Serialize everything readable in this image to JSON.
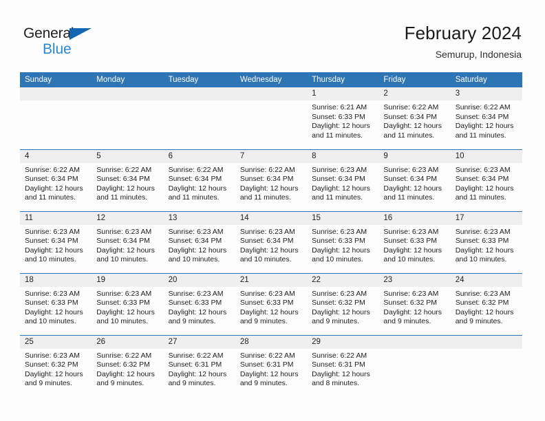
{
  "brand": {
    "name_top": "General",
    "name_bottom": "Blue",
    "triangle_icon": "triangle-icon",
    "accent_blue": "#2787d6",
    "logo_dark": "#231f20"
  },
  "header": {
    "title": "February 2024",
    "subtitle": "Semurup, Indonesia"
  },
  "theme": {
    "header_blue": "#2e75b6",
    "daynum_band": "#efefef",
    "page_bg": "#fdfdfd"
  },
  "calendar": {
    "weekday_headers": [
      "Sunday",
      "Monday",
      "Tuesday",
      "Wednesday",
      "Thursday",
      "Friday",
      "Saturday"
    ],
    "weeks": [
      [
        {
          "day": "",
          "sunrise": "",
          "sunset": "",
          "daylight1": "",
          "daylight2": ""
        },
        {
          "day": "",
          "sunrise": "",
          "sunset": "",
          "daylight1": "",
          "daylight2": ""
        },
        {
          "day": "",
          "sunrise": "",
          "sunset": "",
          "daylight1": "",
          "daylight2": ""
        },
        {
          "day": "",
          "sunrise": "",
          "sunset": "",
          "daylight1": "",
          "daylight2": ""
        },
        {
          "day": "1",
          "sunrise": "Sunrise: 6:21 AM",
          "sunset": "Sunset: 6:33 PM",
          "daylight1": "Daylight: 12 hours",
          "daylight2": "and 11 minutes."
        },
        {
          "day": "2",
          "sunrise": "Sunrise: 6:22 AM",
          "sunset": "Sunset: 6:34 PM",
          "daylight1": "Daylight: 12 hours",
          "daylight2": "and 11 minutes."
        },
        {
          "day": "3",
          "sunrise": "Sunrise: 6:22 AM",
          "sunset": "Sunset: 6:34 PM",
          "daylight1": "Daylight: 12 hours",
          "daylight2": "and 11 minutes."
        }
      ],
      [
        {
          "day": "4",
          "sunrise": "Sunrise: 6:22 AM",
          "sunset": "Sunset: 6:34 PM",
          "daylight1": "Daylight: 12 hours",
          "daylight2": "and 11 minutes."
        },
        {
          "day": "5",
          "sunrise": "Sunrise: 6:22 AM",
          "sunset": "Sunset: 6:34 PM",
          "daylight1": "Daylight: 12 hours",
          "daylight2": "and 11 minutes."
        },
        {
          "day": "6",
          "sunrise": "Sunrise: 6:22 AM",
          "sunset": "Sunset: 6:34 PM",
          "daylight1": "Daylight: 12 hours",
          "daylight2": "and 11 minutes."
        },
        {
          "day": "7",
          "sunrise": "Sunrise: 6:22 AM",
          "sunset": "Sunset: 6:34 PM",
          "daylight1": "Daylight: 12 hours",
          "daylight2": "and 11 minutes."
        },
        {
          "day": "8",
          "sunrise": "Sunrise: 6:23 AM",
          "sunset": "Sunset: 6:34 PM",
          "daylight1": "Daylight: 12 hours",
          "daylight2": "and 11 minutes."
        },
        {
          "day": "9",
          "sunrise": "Sunrise: 6:23 AM",
          "sunset": "Sunset: 6:34 PM",
          "daylight1": "Daylight: 12 hours",
          "daylight2": "and 11 minutes."
        },
        {
          "day": "10",
          "sunrise": "Sunrise: 6:23 AM",
          "sunset": "Sunset: 6:34 PM",
          "daylight1": "Daylight: 12 hours",
          "daylight2": "and 11 minutes."
        }
      ],
      [
        {
          "day": "11",
          "sunrise": "Sunrise: 6:23 AM",
          "sunset": "Sunset: 6:34 PM",
          "daylight1": "Daylight: 12 hours",
          "daylight2": "and 10 minutes."
        },
        {
          "day": "12",
          "sunrise": "Sunrise: 6:23 AM",
          "sunset": "Sunset: 6:34 PM",
          "daylight1": "Daylight: 12 hours",
          "daylight2": "and 10 minutes."
        },
        {
          "day": "13",
          "sunrise": "Sunrise: 6:23 AM",
          "sunset": "Sunset: 6:34 PM",
          "daylight1": "Daylight: 12 hours",
          "daylight2": "and 10 minutes."
        },
        {
          "day": "14",
          "sunrise": "Sunrise: 6:23 AM",
          "sunset": "Sunset: 6:34 PM",
          "daylight1": "Daylight: 12 hours",
          "daylight2": "and 10 minutes."
        },
        {
          "day": "15",
          "sunrise": "Sunrise: 6:23 AM",
          "sunset": "Sunset: 6:33 PM",
          "daylight1": "Daylight: 12 hours",
          "daylight2": "and 10 minutes."
        },
        {
          "day": "16",
          "sunrise": "Sunrise: 6:23 AM",
          "sunset": "Sunset: 6:33 PM",
          "daylight1": "Daylight: 12 hours",
          "daylight2": "and 10 minutes."
        },
        {
          "day": "17",
          "sunrise": "Sunrise: 6:23 AM",
          "sunset": "Sunset: 6:33 PM",
          "daylight1": "Daylight: 12 hours",
          "daylight2": "and 10 minutes."
        }
      ],
      [
        {
          "day": "18",
          "sunrise": "Sunrise: 6:23 AM",
          "sunset": "Sunset: 6:33 PM",
          "daylight1": "Daylight: 12 hours",
          "daylight2": "and 10 minutes."
        },
        {
          "day": "19",
          "sunrise": "Sunrise: 6:23 AM",
          "sunset": "Sunset: 6:33 PM",
          "daylight1": "Daylight: 12 hours",
          "daylight2": "and 10 minutes."
        },
        {
          "day": "20",
          "sunrise": "Sunrise: 6:23 AM",
          "sunset": "Sunset: 6:33 PM",
          "daylight1": "Daylight: 12 hours",
          "daylight2": "and 9 minutes."
        },
        {
          "day": "21",
          "sunrise": "Sunrise: 6:23 AM",
          "sunset": "Sunset: 6:33 PM",
          "daylight1": "Daylight: 12 hours",
          "daylight2": "and 9 minutes."
        },
        {
          "day": "22",
          "sunrise": "Sunrise: 6:23 AM",
          "sunset": "Sunset: 6:32 PM",
          "daylight1": "Daylight: 12 hours",
          "daylight2": "and 9 minutes."
        },
        {
          "day": "23",
          "sunrise": "Sunrise: 6:23 AM",
          "sunset": "Sunset: 6:32 PM",
          "daylight1": "Daylight: 12 hours",
          "daylight2": "and 9 minutes."
        },
        {
          "day": "24",
          "sunrise": "Sunrise: 6:23 AM",
          "sunset": "Sunset: 6:32 PM",
          "daylight1": "Daylight: 12 hours",
          "daylight2": "and 9 minutes."
        }
      ],
      [
        {
          "day": "25",
          "sunrise": "Sunrise: 6:23 AM",
          "sunset": "Sunset: 6:32 PM",
          "daylight1": "Daylight: 12 hours",
          "daylight2": "and 9 minutes."
        },
        {
          "day": "26",
          "sunrise": "Sunrise: 6:22 AM",
          "sunset": "Sunset: 6:32 PM",
          "daylight1": "Daylight: 12 hours",
          "daylight2": "and 9 minutes."
        },
        {
          "day": "27",
          "sunrise": "Sunrise: 6:22 AM",
          "sunset": "Sunset: 6:31 PM",
          "daylight1": "Daylight: 12 hours",
          "daylight2": "and 9 minutes."
        },
        {
          "day": "28",
          "sunrise": "Sunrise: 6:22 AM",
          "sunset": "Sunset: 6:31 PM",
          "daylight1": "Daylight: 12 hours",
          "daylight2": "and 9 minutes."
        },
        {
          "day": "29",
          "sunrise": "Sunrise: 6:22 AM",
          "sunset": "Sunset: 6:31 PM",
          "daylight1": "Daylight: 12 hours",
          "daylight2": "and 8 minutes."
        },
        {
          "day": "",
          "sunrise": "",
          "sunset": "",
          "daylight1": "",
          "daylight2": ""
        },
        {
          "day": "",
          "sunrise": "",
          "sunset": "",
          "daylight1": "",
          "daylight2": ""
        }
      ]
    ]
  }
}
